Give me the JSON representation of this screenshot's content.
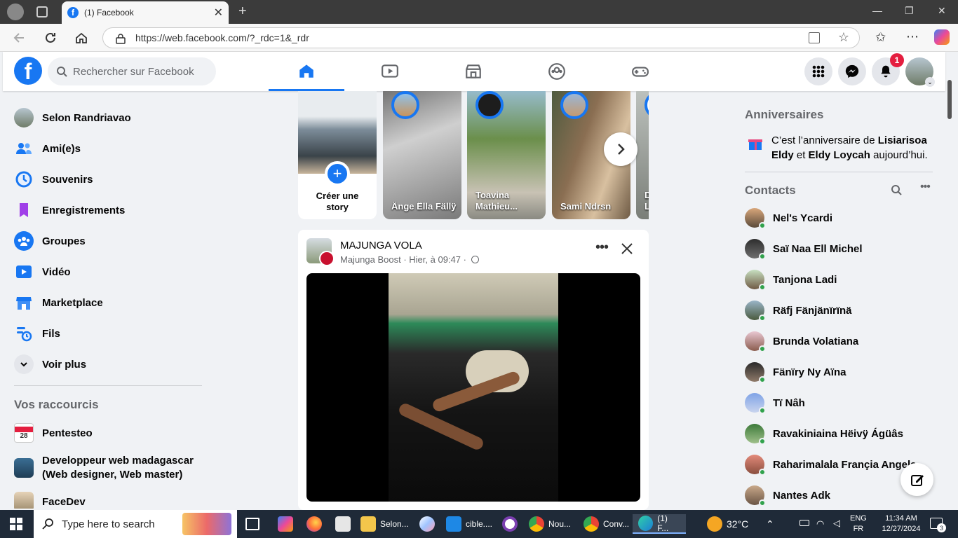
{
  "browser": {
    "tab_title": "(1) Facebook",
    "url": "https://web.facebook.com/?_rdc=1&_rdr"
  },
  "fb": {
    "search_placeholder": "Rechercher sur Facebook",
    "notification_count": "1"
  },
  "left_nav": {
    "items": [
      {
        "label": "Selon Randriavao",
        "icon": "profile-avatar"
      },
      {
        "label": "Ami(e)s",
        "icon": "friends-icon"
      },
      {
        "label": "Souvenirs",
        "icon": "memories-icon"
      },
      {
        "label": "Enregistrements",
        "icon": "saved-icon"
      },
      {
        "label": "Groupes",
        "icon": "groups-icon"
      },
      {
        "label": "Vidéo",
        "icon": "video-icon"
      },
      {
        "label": "Marketplace",
        "icon": "marketplace-icon"
      },
      {
        "label": "Fils",
        "icon": "feeds-icon"
      },
      {
        "label": "Voir plus",
        "icon": "chevron-down-icon"
      }
    ],
    "shortcuts_title": "Vos raccourcis",
    "shortcuts": [
      {
        "label": "Pentesteo",
        "badge": "28"
      },
      {
        "label": "Developpeur web madagascar (Web designer, Web master)"
      },
      {
        "label": "FaceDev"
      }
    ]
  },
  "stories": {
    "create_label": "Créer une story",
    "items": [
      {
        "name": "Änge Ëlla Fällÿ"
      },
      {
        "name": "Toavina Mathieu..."
      },
      {
        "name": "Sami Ndrsn"
      },
      {
        "name": "D L"
      }
    ]
  },
  "post": {
    "page_name": "MAJUNGA VOLA",
    "meta": "Majunga Boost · Hier, à 09:47 ·"
  },
  "right": {
    "birthdays_title": "Anniversaires",
    "birthday_prefix": "C’est l’anniversaire de ",
    "birthday_name1": "Lisiarisoa Eldy",
    "birthday_and": " et ",
    "birthday_name2": "Eldy Loycah",
    "birthday_suffix": " aujourd’hui.",
    "contacts_title": "Contacts",
    "contacts": [
      {
        "name": "Nel's Ycardi"
      },
      {
        "name": "Saï Naa Ell Michel"
      },
      {
        "name": "Tanjona Ladi"
      },
      {
        "name": "Räfj Fänjänïrïnä"
      },
      {
        "name": "Brunda Volatiana"
      },
      {
        "name": "Fänïry Ny Aïna"
      },
      {
        "name": "Tï Nâh"
      },
      {
        "name": "Ravakiniaina Hëivÿ Ágüâs"
      },
      {
        "name": "Raharimalala Françia Angela"
      },
      {
        "name": "Nantes Adk"
      }
    ]
  },
  "taskbar": {
    "search_placeholder": "Type here to search",
    "apps": [
      {
        "label": "Selon..."
      },
      {
        "label": "cible...."
      },
      {
        "label": "Nou..."
      },
      {
        "label": "Conv..."
      },
      {
        "label": "(1) F..."
      }
    ],
    "weather": "32°C",
    "lang1": "ENG",
    "lang2": "FR",
    "time": "11:34 AM",
    "date": "12/27/2024",
    "notif_count": "3"
  },
  "colors": {
    "fb_blue": "#1877f2",
    "bg": "#f0f2f5",
    "online_green": "#31a24c",
    "badge_red": "#e41e3f"
  }
}
